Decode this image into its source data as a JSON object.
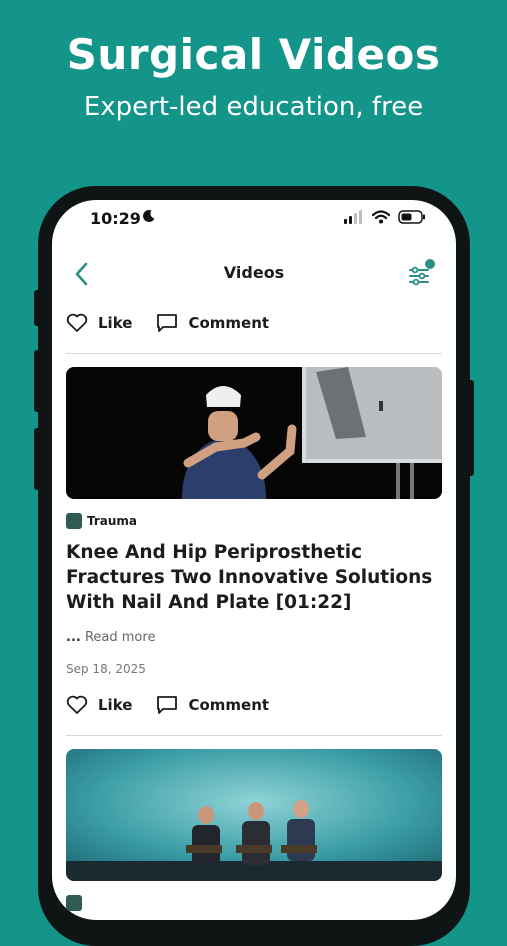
{
  "promo": {
    "title": "Surgical Videos",
    "subtitle": "Expert-led education, free"
  },
  "status_bar": {
    "time": "10:29",
    "icons": [
      "moon-icon",
      "cellular-signal-icon",
      "wifi-icon",
      "battery-icon"
    ]
  },
  "nav": {
    "title": "Videos",
    "back_icon": "chevron-left-icon",
    "filter_icon": "sliders-icon"
  },
  "actions": {
    "like_label": "Like",
    "comment_label": "Comment"
  },
  "posts": [
    {
      "category": "Trauma",
      "title": "Knee And Hip Periprosthetic Fractures Two Innovative Solutions With Nail And Plate [01:22]",
      "read_more_prefix": "...",
      "read_more": "Read more",
      "date": "Sep 18, 2025"
    },
    {
      "category": "",
      "title": ""
    }
  ],
  "colors": {
    "brand": "#14958a",
    "accent": "#2a8f86",
    "text": "#1c1c1c"
  }
}
